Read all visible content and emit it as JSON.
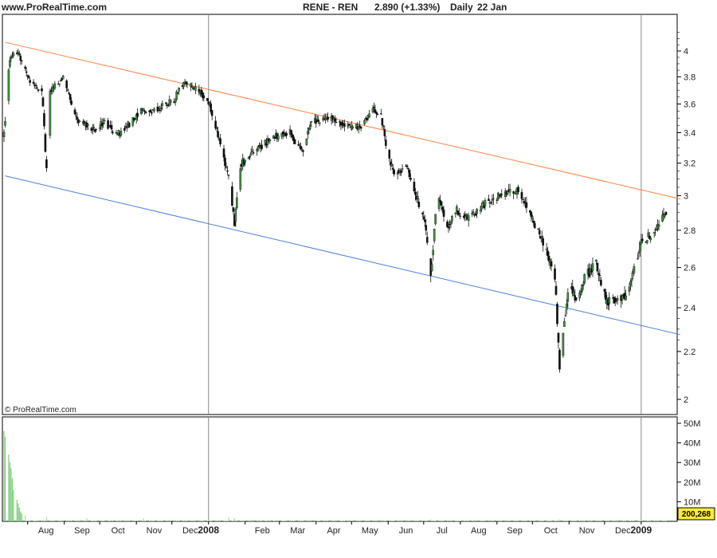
{
  "header": {
    "site": "www.ProRealTime.com",
    "instrument": "RENE - REN",
    "last": "2.890 (+1.33%)",
    "period": "Daily",
    "date": "22 Jan"
  },
  "credit": "© ProRealTime.com",
  "volume_last_label": "200,268",
  "chart_data": [
    {
      "type": "candlestick",
      "title": "RENE - REN",
      "y_scale": "log",
      "ylim": [
        1.95,
        4.2
      ],
      "y_ticks": [
        2,
        2.2,
        2.4,
        2.6,
        2.8,
        3,
        3.2,
        3.4,
        3.6,
        3.8,
        4
      ],
      "x_ticks": [
        "Aug",
        "Sep",
        "Oct",
        "Nov",
        "Dec",
        "2008",
        "Feb",
        "Mar",
        "Apr",
        "May",
        "Jun",
        "Jul",
        "Aug",
        "Sep",
        "Oct",
        "Nov",
        "Dec",
        "2009"
      ],
      "x_range": [
        "2007-07-12",
        "2009-01-22"
      ],
      "grid": "vertical lines at 2008 and 2009",
      "colors": {
        "up": "#3f8f3f",
        "down": "#111111",
        "resistance": "#ff8040",
        "support": "#4a7fe0"
      },
      "trendlines": [
        {
          "points": [
            [
              "2007-07-13",
              4.07
            ],
            [
              "2009-01-22",
              3.0
            ]
          ]
        },
        {
          "points": [
            [
              "2007-07-13",
              3.12
            ],
            [
              "2009-01-22",
              2.29
            ]
          ]
        }
      ],
      "price_path": [
        [
          "2007-07-12",
          3.38
        ],
        [
          "2007-07-17",
          3.95
        ],
        [
          "2007-07-24",
          3.98
        ],
        [
          "2007-08-03",
          3.75
        ],
        [
          "2007-08-13",
          3.7
        ],
        [
          "2007-08-17",
          3.15
        ],
        [
          "2007-08-20",
          3.68
        ],
        [
          "2007-08-31",
          3.8
        ],
        [
          "2007-09-12",
          3.48
        ],
        [
          "2007-09-25",
          3.42
        ],
        [
          "2007-10-05",
          3.48
        ],
        [
          "2007-10-15",
          3.38
        ],
        [
          "2007-10-25",
          3.45
        ],
        [
          "2007-11-05",
          3.55
        ],
        [
          "2007-11-20",
          3.57
        ],
        [
          "2007-12-03",
          3.63
        ],
        [
          "2007-12-10",
          3.75
        ],
        [
          "2007-12-24",
          3.7
        ],
        [
          "2008-01-02",
          3.6
        ],
        [
          "2008-01-10",
          3.35
        ],
        [
          "2008-01-18",
          3.1
        ],
        [
          "2008-01-23",
          2.85
        ],
        [
          "2008-01-29",
          3.2
        ],
        [
          "2008-02-07",
          3.27
        ],
        [
          "2008-02-25",
          3.37
        ],
        [
          "2008-03-10",
          3.4
        ],
        [
          "2008-03-20",
          3.27
        ],
        [
          "2008-03-28",
          3.48
        ],
        [
          "2008-04-15",
          3.5
        ],
        [
          "2008-05-02",
          3.43
        ],
        [
          "2008-05-09",
          3.45
        ],
        [
          "2008-05-20",
          3.56
        ],
        [
          "2008-05-26",
          3.52
        ],
        [
          "2008-05-30",
          3.33
        ],
        [
          "2008-06-06",
          3.12
        ],
        [
          "2008-06-16",
          3.18
        ],
        [
          "2008-06-25",
          3.0
        ],
        [
          "2008-07-03",
          2.8
        ],
        [
          "2008-07-07",
          2.55
        ],
        [
          "2008-07-13",
          3.03
        ],
        [
          "2008-07-21",
          2.82
        ],
        [
          "2008-07-28",
          2.92
        ],
        [
          "2008-08-08",
          2.86
        ],
        [
          "2008-08-20",
          2.94
        ],
        [
          "2008-09-05",
          3.01
        ],
        [
          "2008-09-20",
          3.03
        ],
        [
          "2008-10-02",
          2.85
        ],
        [
          "2008-10-10",
          2.73
        ],
        [
          "2008-10-20",
          2.55
        ],
        [
          "2008-10-24",
          2.12
        ],
        [
          "2008-11-01",
          2.53
        ],
        [
          "2008-11-08",
          2.42
        ],
        [
          "2008-11-14",
          2.55
        ],
        [
          "2008-11-24",
          2.62
        ],
        [
          "2008-12-03",
          2.42
        ],
        [
          "2008-12-10",
          2.45
        ],
        [
          "2008-12-20",
          2.45
        ],
        [
          "2008-12-31",
          2.72
        ],
        [
          "2009-01-10",
          2.78
        ],
        [
          "2009-01-16",
          2.84
        ],
        [
          "2009-01-22",
          2.89
        ]
      ]
    },
    {
      "type": "bar",
      "title": "",
      "ylim": [
        0,
        58
      ],
      "y_ticks": [
        "10M",
        "20M",
        "30M",
        "40M",
        "50M"
      ],
      "values_in_millions": [
        [
          "2007-07-12",
          46
        ],
        [
          "2007-07-13",
          43
        ],
        [
          "2007-07-16",
          34
        ],
        [
          "2007-07-17",
          30
        ],
        [
          "2007-07-18",
          27
        ],
        [
          "2007-07-19",
          22
        ],
        [
          "2007-07-20",
          16
        ],
        [
          "2007-07-23",
          11
        ],
        [
          "2007-07-24",
          9
        ],
        [
          "2007-07-25",
          7
        ],
        [
          "2007-07-26",
          5
        ],
        [
          "2007-07-27",
          4
        ],
        [
          "2007-07-30",
          3
        ],
        [
          "2007-08-17",
          2
        ],
        [
          "2007-09-20",
          1.5
        ],
        [
          "2007-11-07",
          1.5
        ],
        [
          "2008-01-18",
          2
        ],
        [
          "2008-01-23",
          1.5
        ],
        [
          "2008-07-07",
          1
        ],
        [
          "2008-10-24",
          1
        ],
        [
          "2009-01-22",
          0.2
        ]
      ]
    }
  ]
}
